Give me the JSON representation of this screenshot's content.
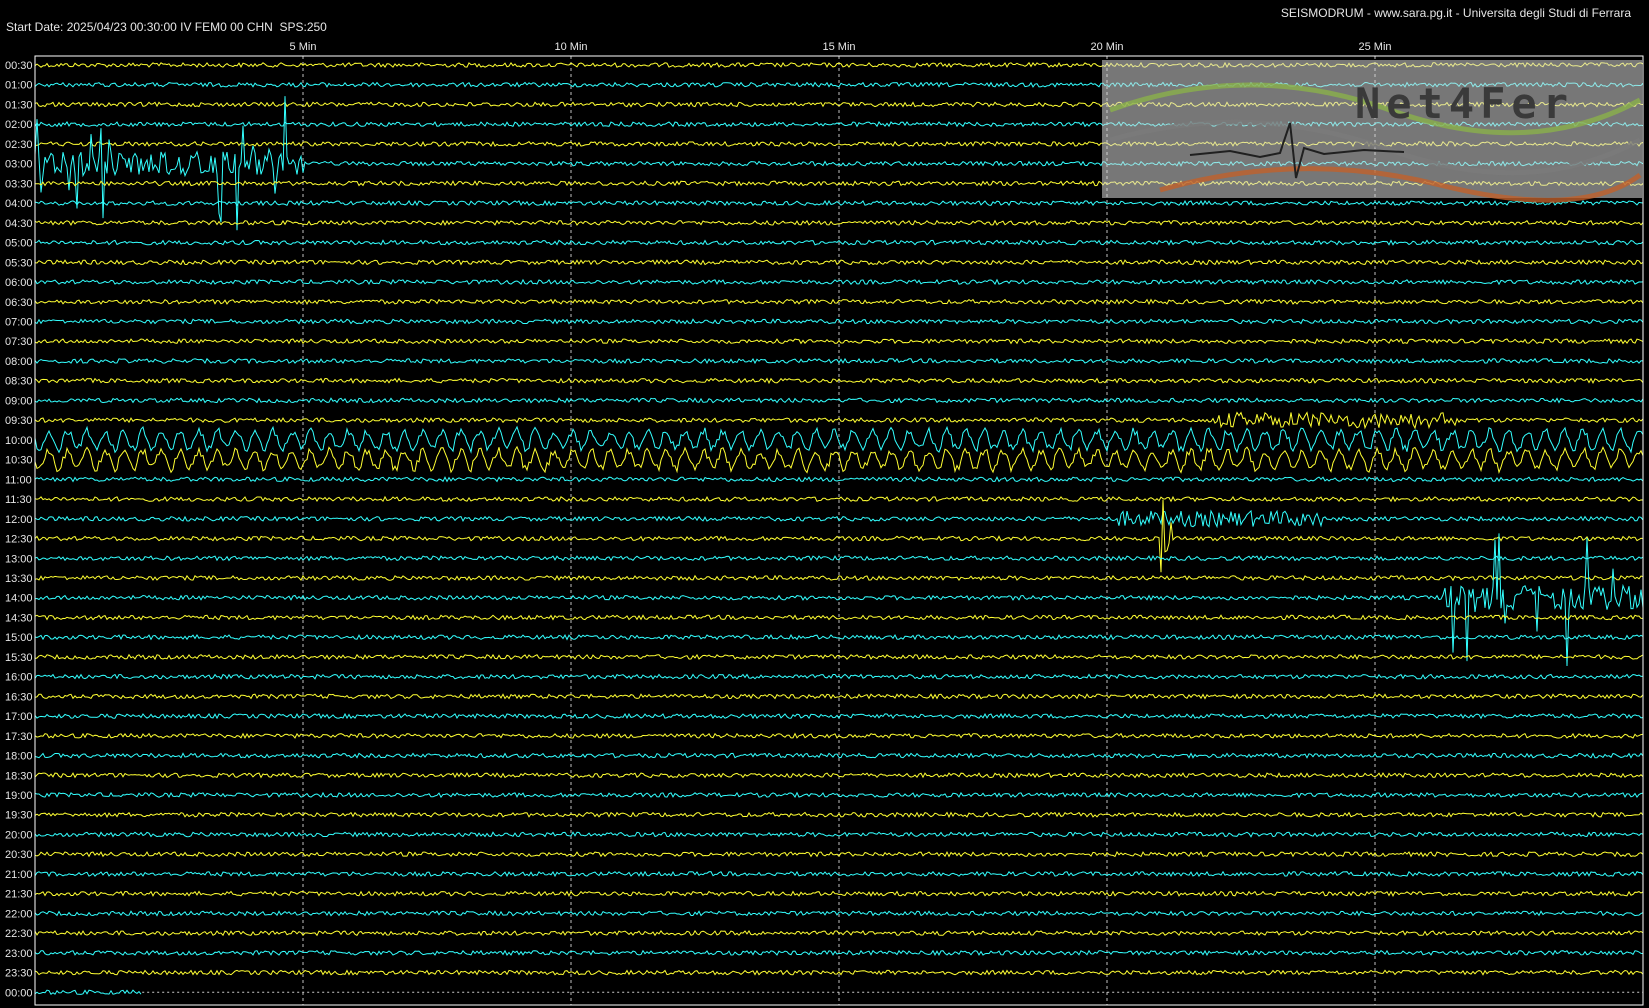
{
  "header": {
    "start_info": "Start Date: 2025/04/23 00:30:00 IV FEM0 00 CHN  SPS:250",
    "credits": "SEISMODRUM - www.sara.pg.it - Universita degli Studi di Ferrara"
  },
  "logo": {
    "text": "Net4Fer"
  },
  "colors": {
    "background": "#000000",
    "trace_a": "#ffff33",
    "trace_b": "#33ffff",
    "frame": "#ffffff",
    "grid": "#bfbfbf"
  },
  "chart_data": {
    "type": "line",
    "x_unit": "Min",
    "xlim": [
      0,
      30
    ],
    "x_ticks": [
      {
        "value": 5,
        "label": "5 Min"
      },
      {
        "value": 10,
        "label": "10 Min"
      },
      {
        "value": 15,
        "label": "15 Min"
      },
      {
        "value": 20,
        "label": "20 Min"
      },
      {
        "value": 25,
        "label": "25 Min"
      }
    ],
    "row_labels": [
      "00:30",
      "01:00",
      "01:30",
      "02:00",
      "02:30",
      "03:00",
      "03:30",
      "04:00",
      "04:30",
      "05:00",
      "05:30",
      "06:00",
      "06:30",
      "07:00",
      "07:30",
      "08:00",
      "08:30",
      "09:00",
      "09:30",
      "10:00",
      "10:30",
      "11:00",
      "11:30",
      "12:00",
      "12:30",
      "13:00",
      "13:30",
      "14:00",
      "14:30",
      "15:00",
      "15:30",
      "16:00",
      "16:30",
      "17:00",
      "17:30",
      "18:00",
      "18:30",
      "19:00",
      "19:30",
      "20:00",
      "20:30",
      "21:00",
      "21:30",
      "22:00",
      "22:30",
      "23:00",
      "23:30",
      "00:00"
    ],
    "trace_colors": [
      "yellow",
      "cyan"
    ],
    "events": [
      {
        "row": "03:00",
        "start_min": 0.0,
        "end_min": 5.0,
        "label": "large early transients"
      },
      {
        "row": "10:00",
        "start_min": 0.0,
        "end_min": 30.0,
        "label": "long-period waves"
      },
      {
        "row": "10:30",
        "start_min": 0.0,
        "end_min": 30.0,
        "label": "long-period waves"
      },
      {
        "row": "12:00",
        "start_min": 20.2,
        "end_min": 24.0,
        "label": "burst"
      },
      {
        "row": "12:30",
        "start_min": 21.0,
        "end_min": 21.2,
        "label": "spike"
      },
      {
        "row": "09:30",
        "start_min": 22.0,
        "end_min": 26.5,
        "label": "burst"
      },
      {
        "row": "14:00",
        "start_min": 26.2,
        "end_min": 30.0,
        "label": "large late transients"
      }
    ],
    "grid": true,
    "legend": "none"
  }
}
